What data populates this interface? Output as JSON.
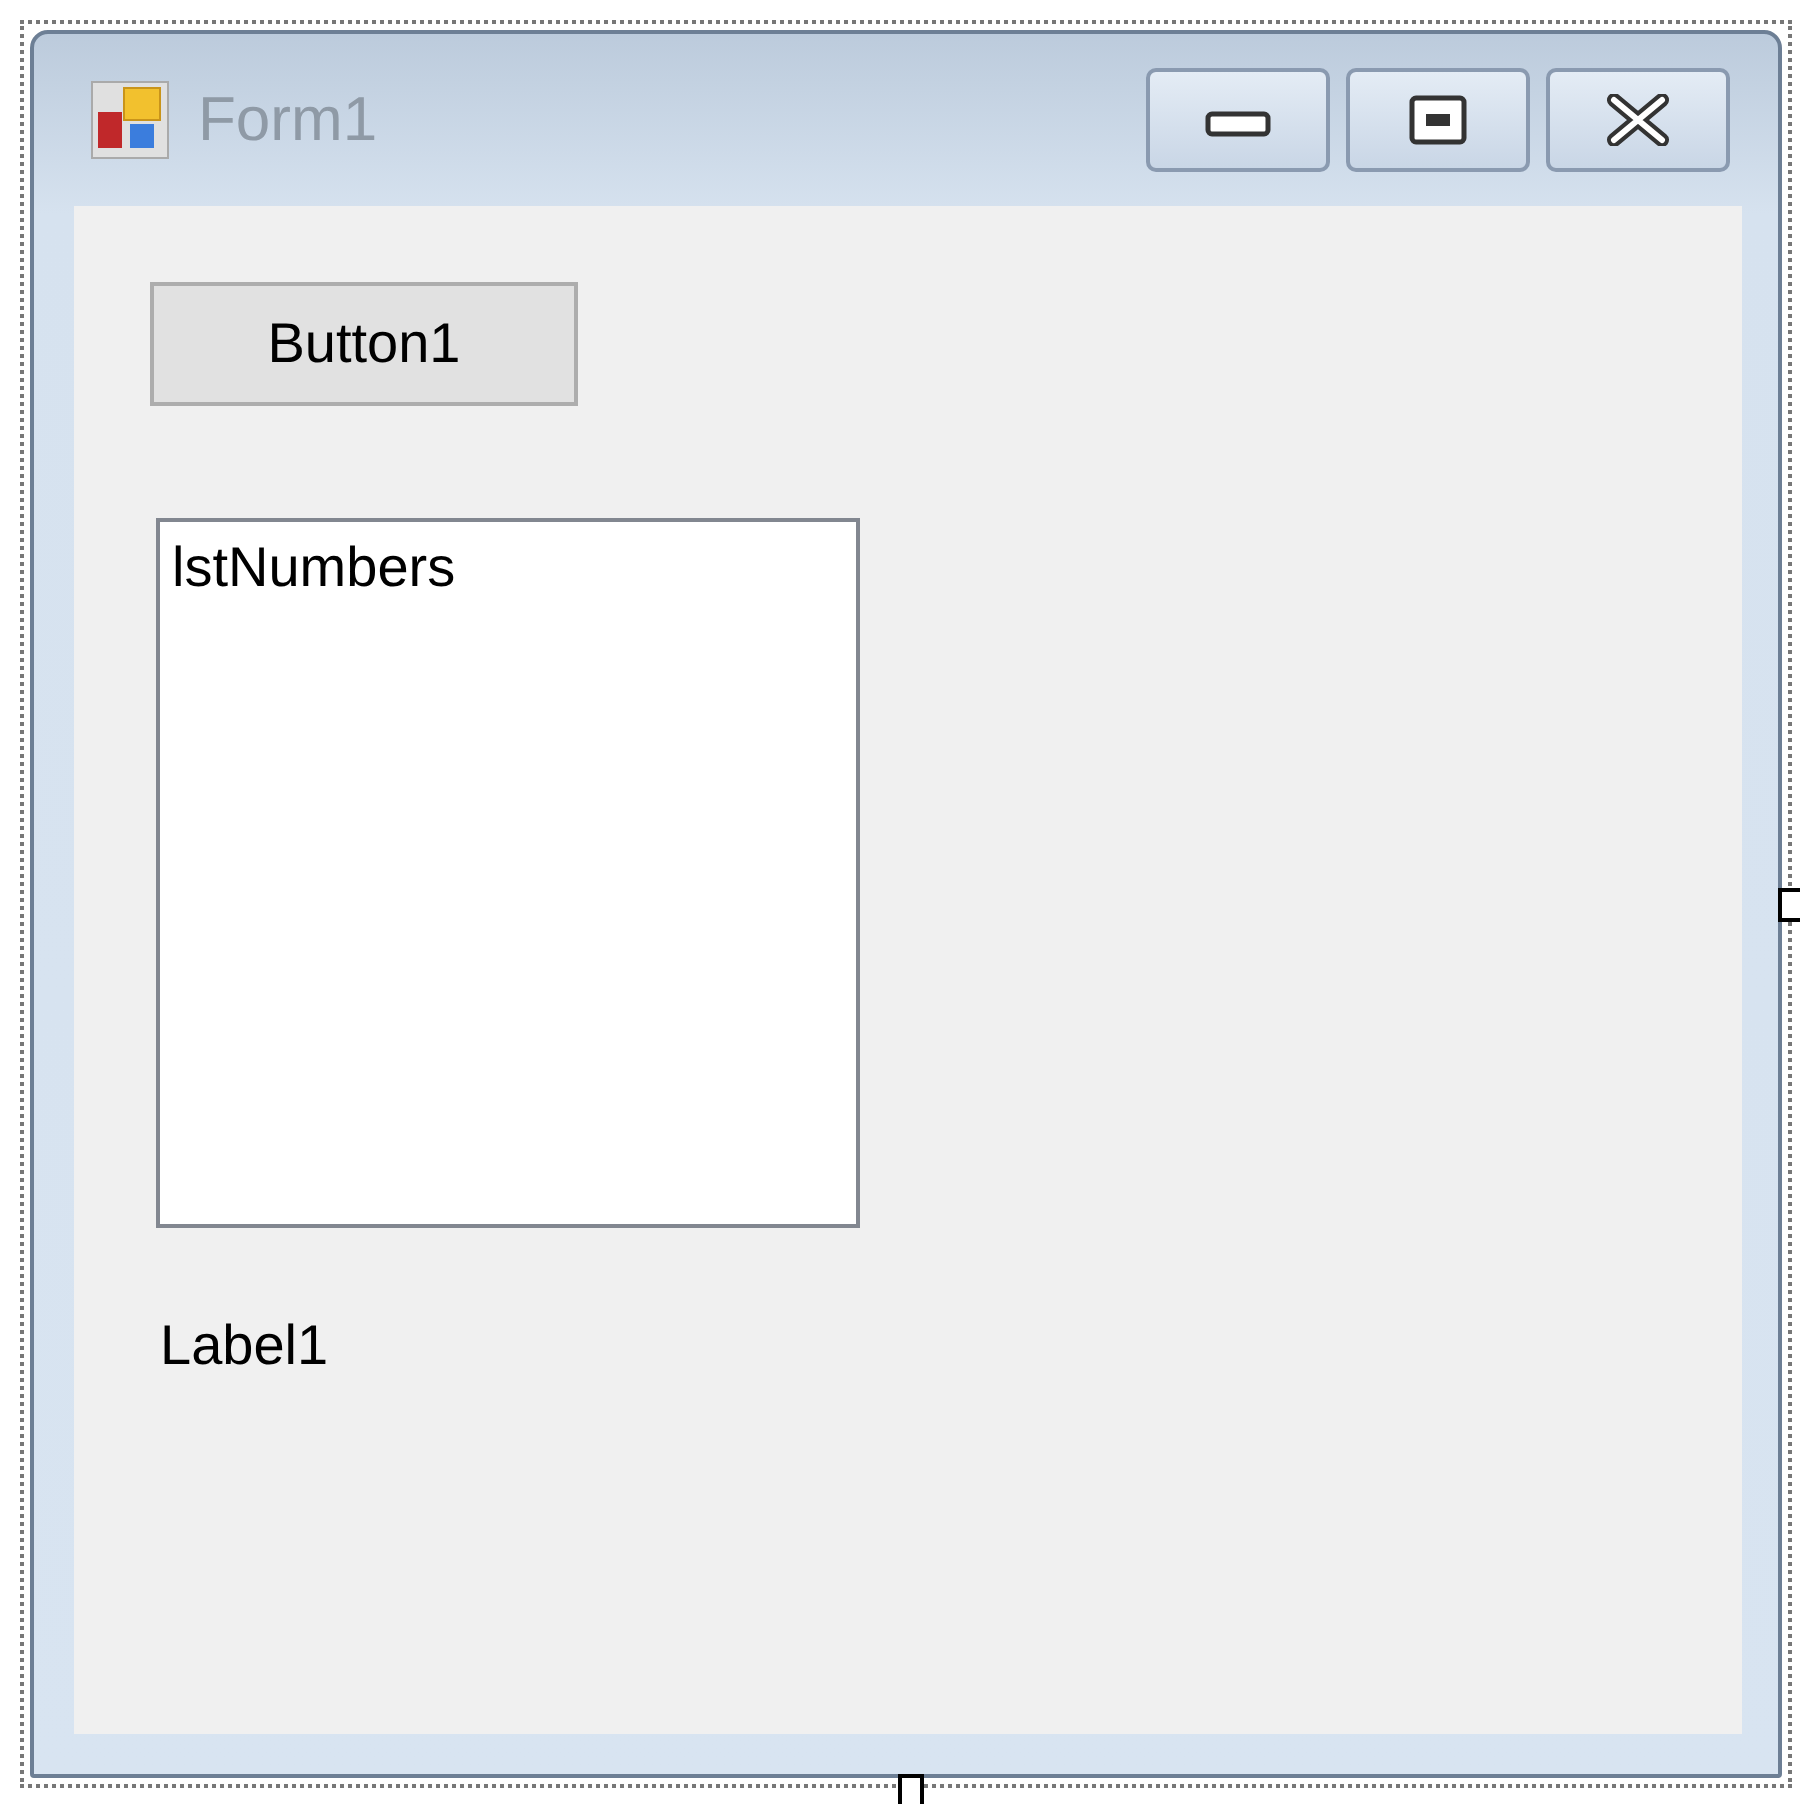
{
  "window": {
    "title": "Form1",
    "controls": [
      {
        "kind": "minimize"
      },
      {
        "kind": "maximize"
      },
      {
        "kind": "close"
      }
    ]
  },
  "button": {
    "label": "Button1"
  },
  "listbox": {
    "items": [
      "lstNumbers"
    ]
  },
  "label": {
    "text": "Label1"
  }
}
